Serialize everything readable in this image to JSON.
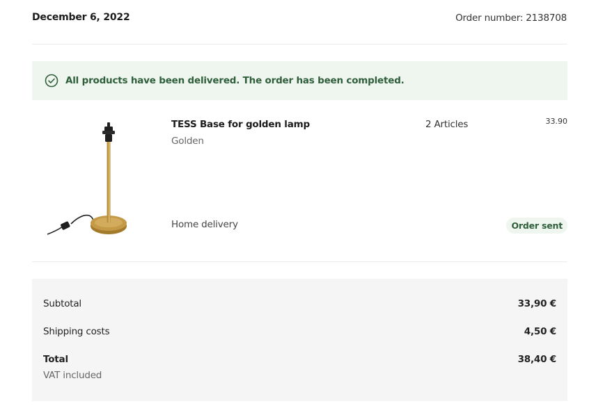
{
  "header": {
    "date": "December 6, 2022",
    "order_number": "Order number: 2138708"
  },
  "status_banner": {
    "icon": "check-circle-icon",
    "text": "All products have been delivered. The order has been completed."
  },
  "product": {
    "image": "lamp-base-image",
    "name": "TESS Base for golden lamp",
    "variant": "Golden",
    "quantity": "2 Articles",
    "price": "33.90",
    "delivery_method": "Home delivery",
    "status": "Order sent"
  },
  "summary": {
    "subtotal_label": "Subtotal",
    "subtotal_value": "33,90 €",
    "shipping_label": "Shipping costs",
    "shipping_value": "4,50 €",
    "total_label": "Total",
    "total_value": "38,40 €",
    "vat_note": "VAT included"
  },
  "colors": {
    "success_bg": "#eef6ef",
    "success_text": "#2f5e3a",
    "summary_bg": "#f5f5f5",
    "lamp_gold": "#b58a3a"
  }
}
